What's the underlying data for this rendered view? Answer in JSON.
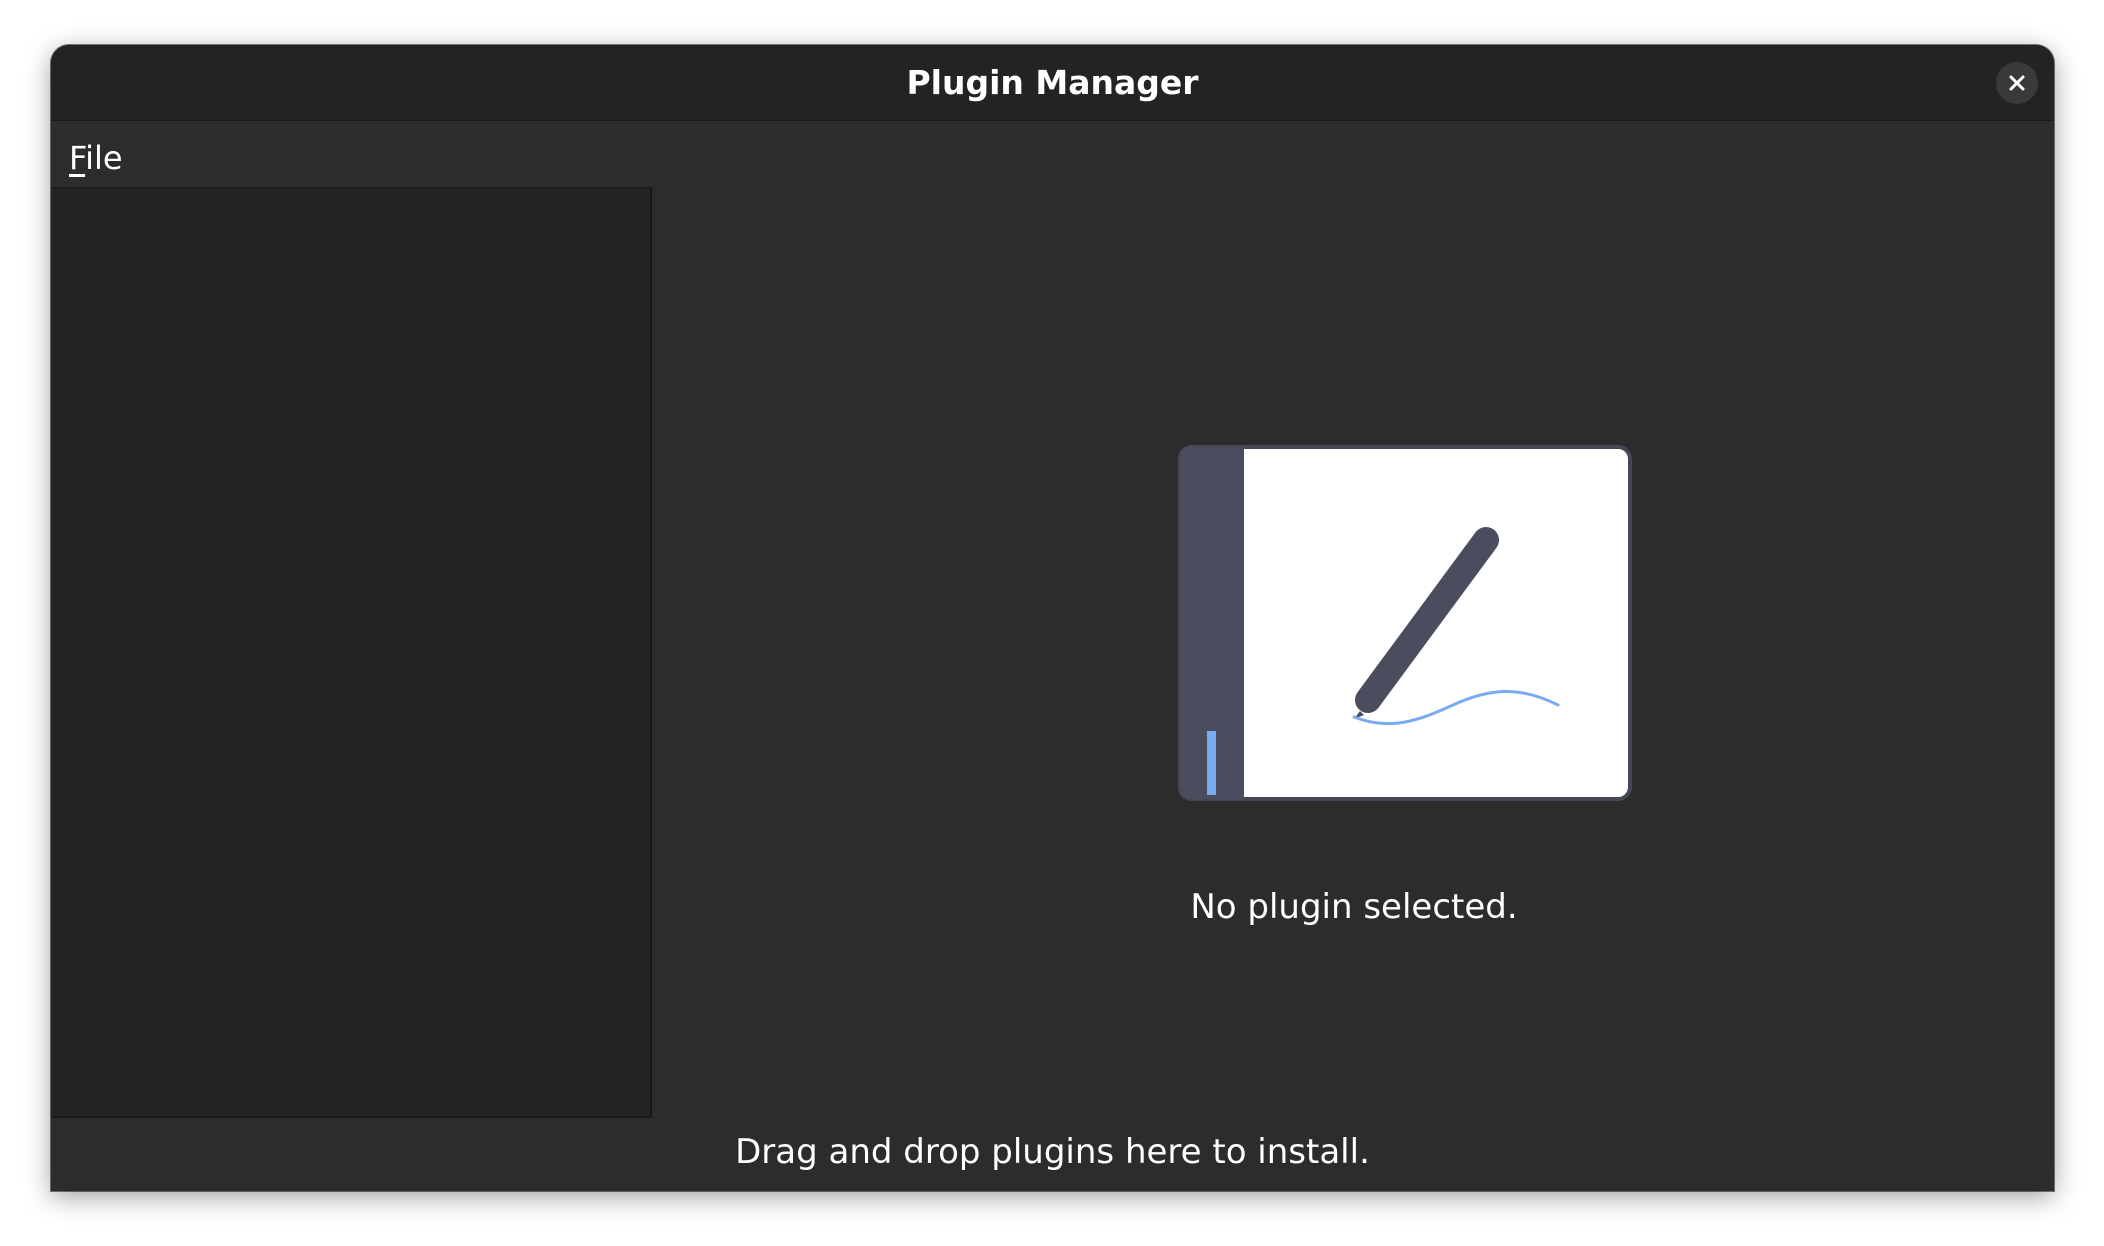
{
  "window": {
    "title": "Plugin Manager"
  },
  "menubar": {
    "items": [
      {
        "label": "File",
        "mnemonic": "F",
        "rest": "ile"
      }
    ]
  },
  "main": {
    "empty_state_text": "No plugin selected.",
    "illustration_icon": "pen-on-paper-icon"
  },
  "footer": {
    "hint": "Drag and drop plugins here to install."
  },
  "colors": {
    "window_bg": "#2c2c2c",
    "titlebar_bg": "#232323",
    "sidebar_bg": "#242424",
    "accent": "#7aaaf0",
    "illustration_dark": "#4a4d5e",
    "illustration_paper": "#ffffff"
  }
}
